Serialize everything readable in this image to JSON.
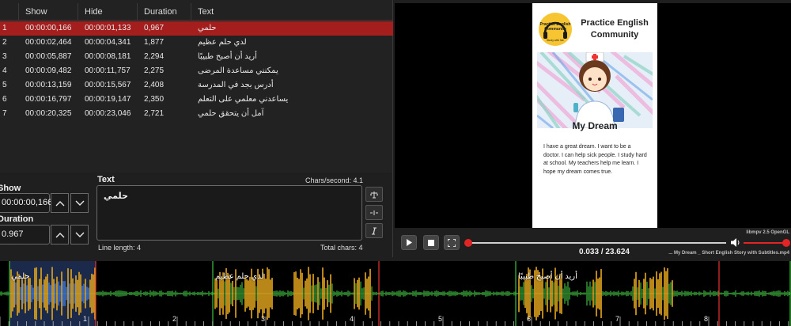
{
  "grid": {
    "columns": [
      "",
      "Show",
      "Hide",
      "Duration",
      "Text"
    ],
    "rows": [
      {
        "num": "1",
        "show": "00:00:00,166",
        "hide": "00:00:01,133",
        "duration": "0,967",
        "text": "حلمي"
      },
      {
        "num": "2",
        "show": "00:00:02,464",
        "hide": "00:00:04,341",
        "duration": "1,877",
        "text": "لدي حلم عظيم"
      },
      {
        "num": "3",
        "show": "00:00:05,887",
        "hide": "00:00:08,181",
        "duration": "2,294",
        "text": "أريد أن أصبح طبيبًا"
      },
      {
        "num": "4",
        "show": "00:00:09,482",
        "hide": "00:00:11,757",
        "duration": "2,275",
        "text": "يمكنني مساعدة المرضى"
      },
      {
        "num": "5",
        "show": "00:00:13,159",
        "hide": "00:00:15,567",
        "duration": "2,408",
        "text": "أدرس بجد في المدرسة"
      },
      {
        "num": "6",
        "show": "00:00:16,797",
        "hide": "00:00:19,147",
        "duration": "2,350",
        "text": "يساعدني معلمي على التعلم"
      },
      {
        "num": "7",
        "show": "00:00:20,325",
        "hide": "00:00:23,046",
        "duration": "2,721",
        "text": "آمل أن يتحقق حلمي"
      }
    ]
  },
  "edit": {
    "show_label": "Show",
    "show_value": "00:00:00,166",
    "duration_label": "Duration",
    "duration_value": "0.967",
    "text_label": "Text",
    "chars_per_second": "Chars/second: 4.1",
    "text_value": "حلمي",
    "line_length": "Line length:  4",
    "total_chars": "Total chars: 4"
  },
  "video": {
    "logo_text": "Practice English Community",
    "logo_subtext": "Study with Me",
    "brand": "Practice English Community",
    "story_title": "My Dream",
    "story_text": "I have a great dream. I want to be a doctor. I can help sick people. I study hard at school. My teachers help me learn. I hope my dream comes true."
  },
  "player": {
    "time": "0.033 / 23.624",
    "engine": "libmpv 2.5 OpenGL",
    "filename": "... My Dream _ Short English Story with Subtitles.mp4",
    "seek_fraction": 0.0014,
    "volume_fraction": 1.0
  },
  "waveform": {
    "labels": [
      "حلمي",
      "لدي حلم عظيم",
      "أريد أن أصبح طبيبًا"
    ],
    "seconds": [
      "1",
      "2",
      "3",
      "4",
      "5",
      "6",
      "7",
      "8"
    ]
  },
  "colors": {
    "selected_row": "#a51e1e",
    "accent": "#e32424",
    "wave_selected": "#3a73d6",
    "wave_normal": "#2f8a2f",
    "wave_peak": "#e8a81e"
  }
}
